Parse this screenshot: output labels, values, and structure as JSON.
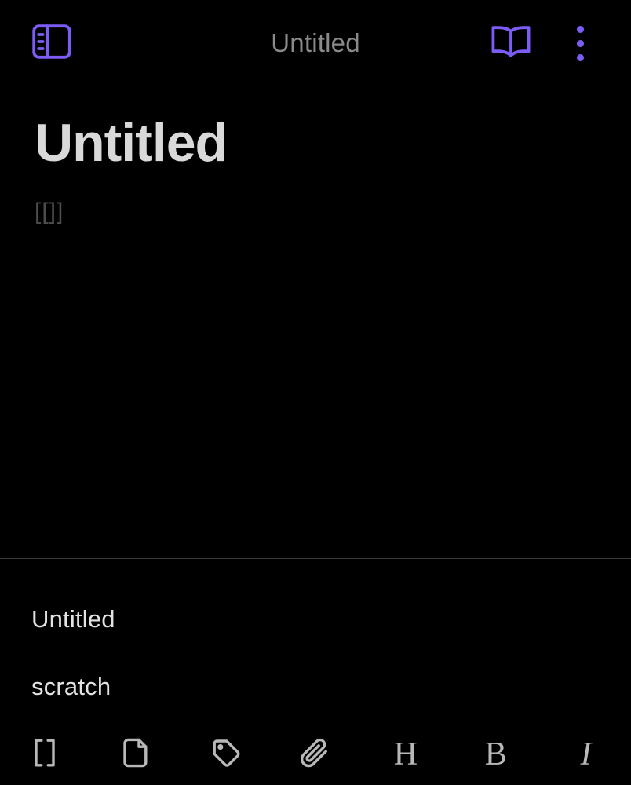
{
  "theme": {
    "background": "#000000",
    "accent": "#7c5cf5",
    "title_text": "#d9d9d9",
    "muted_text": "#8a8a8a",
    "placeholder_text": "#4d4d4d",
    "icon_stroke": "#b8b8b8",
    "divider": "#3a3a3a"
  },
  "appbar": {
    "title": "Untitled",
    "sidebar_toggle_icon": "sidebar-panel-icon",
    "reading_view_icon": "open-book-icon",
    "more_options_icon": "more-vertical-icon"
  },
  "editor": {
    "note_title": "Untitled",
    "body_text": "[[]]"
  },
  "suggestions": {
    "items": [
      {
        "label": "Untitled"
      },
      {
        "label": "scratch"
      }
    ]
  },
  "toolbar": {
    "items": [
      {
        "name": "insert-link-button",
        "icon": "brackets-icon",
        "glyph": ""
      },
      {
        "name": "insert-note-button",
        "icon": "file-icon",
        "glyph": ""
      },
      {
        "name": "insert-tag-button",
        "icon": "tag-icon",
        "glyph": ""
      },
      {
        "name": "insert-attachment-button",
        "icon": "paperclip-icon",
        "glyph": ""
      },
      {
        "name": "heading-button",
        "icon": "heading-icon",
        "glyph": "H"
      },
      {
        "name": "bold-button",
        "icon": "bold-icon",
        "glyph": "B"
      },
      {
        "name": "italic-button",
        "icon": "italic-icon",
        "glyph": "I"
      }
    ]
  }
}
